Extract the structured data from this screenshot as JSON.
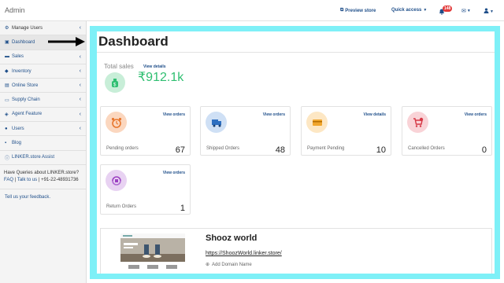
{
  "header": {
    "brand": "Admin",
    "preview_store": "Preview store",
    "quick_access": "Quick access",
    "notification_count": "148"
  },
  "sidebar": {
    "items": [
      {
        "label": "Manage Users",
        "icon": "users-cog-icon",
        "chevron": true
      },
      {
        "label": "Dashboard",
        "icon": "dashboard-icon",
        "chevron": false
      },
      {
        "label": "Sales",
        "icon": "cart-icon",
        "chevron": true
      },
      {
        "label": "Inventory",
        "icon": "tag-icon",
        "chevron": true
      },
      {
        "label": "Online Store",
        "icon": "store-icon",
        "chevron": true
      },
      {
        "label": "Supply Chain",
        "icon": "truck-icon",
        "chevron": true
      },
      {
        "label": "Agent Feature",
        "icon": "handshake-icon",
        "chevron": true
      },
      {
        "label": "Users",
        "icon": "user-icon",
        "chevron": true
      },
      {
        "label": "Blog",
        "icon": "blog-icon",
        "chevron": false
      },
      {
        "label": "LINKER.store Assist",
        "icon": "info-icon",
        "chevron": false
      }
    ],
    "queries_text": "Have Queries about LINKER.store?",
    "faq": "FAQ",
    "talk": "Talk to us",
    "phone": "+91-22-48931736",
    "feedback": "Tell us your feedback."
  },
  "main": {
    "title": "Dashboard",
    "total_sales_label": "Total sales",
    "total_sales_link": "View details",
    "total_sales_value": "₹912.1k",
    "cards": [
      {
        "label": "Pending orders",
        "link": "View orders",
        "count": "67",
        "icon": "alarm-clock-icon",
        "color": "#fbd7bf"
      },
      {
        "label": "Shipped Orders",
        "link": "View orders",
        "count": "48",
        "icon": "truck-icon",
        "color": "#cfe0f5"
      },
      {
        "label": "Payment Pending",
        "link": "View details",
        "count": "10",
        "icon": "card-icon",
        "color": "#fde7c4"
      },
      {
        "label": "Cancelled Orders",
        "link": "View orders",
        "count": "0",
        "icon": "cart-cancel-icon",
        "color": "#f9d3d7"
      },
      {
        "label": "Return Orders",
        "link": "View orders",
        "count": "1",
        "icon": "return-icon",
        "color": "#e8d2f2"
      }
    ],
    "store": {
      "name": "Shooz world",
      "url": "https://ShoozWorld.linker.store/",
      "add_domain": "Add Domain Name"
    }
  },
  "colors": {
    "accent": "#1f4f8a",
    "highlight_frame": "#7ef0f7",
    "sales_green": "#2fbf71",
    "badge_red": "#e23b3b"
  }
}
